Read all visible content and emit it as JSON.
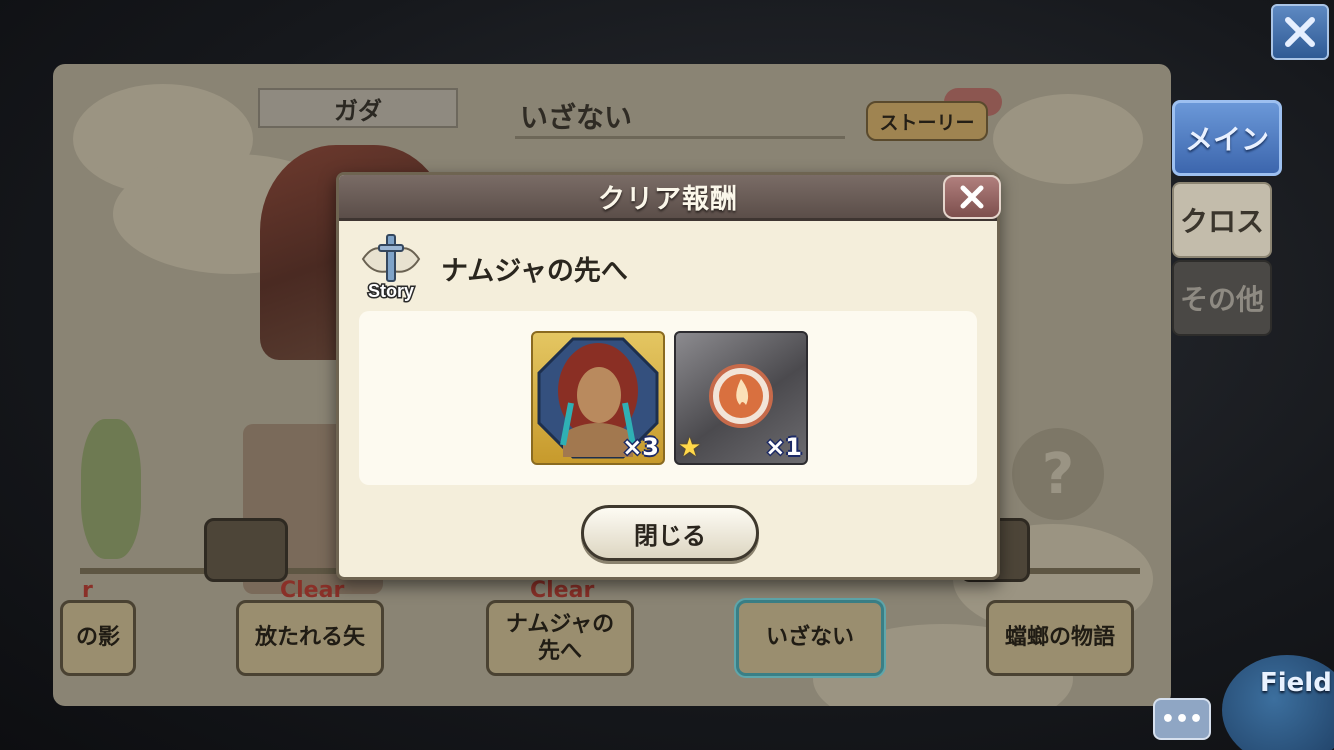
{
  "top_close": {
    "icon": "close-icon"
  },
  "side_tabs": {
    "main": "メイン",
    "cross": "クロス",
    "other": "その他"
  },
  "board": {
    "character_name": "ガダ",
    "quest_title": "いざない",
    "story_button": "ストーリー",
    "nodes": [
      {
        "label": "の影",
        "clear": "r"
      },
      {
        "label": "放たれる矢",
        "clear": "Clear"
      },
      {
        "label": "ナムジャの\n先へ",
        "clear": "Clear"
      },
      {
        "label": "いざない",
        "clear": ""
      },
      {
        "label": "蟷螂の物語",
        "clear": ""
      }
    ],
    "help_mark": "?"
  },
  "dialog": {
    "title": "クリア報酬",
    "story_badge": "Story",
    "quest_name": "ナムジャの先へ",
    "rewards": [
      {
        "type": "hero",
        "count": "×3"
      },
      {
        "type": "crystal",
        "count": "×1",
        "star": "★"
      }
    ],
    "close_label": "閉じる"
  },
  "bottom": {
    "chat_label": "•••",
    "field_label": "Field"
  },
  "colors": {
    "accent_blue": "#3c66ad",
    "dialog_header": "#6b5e58",
    "clear_red": "#8a3028"
  }
}
